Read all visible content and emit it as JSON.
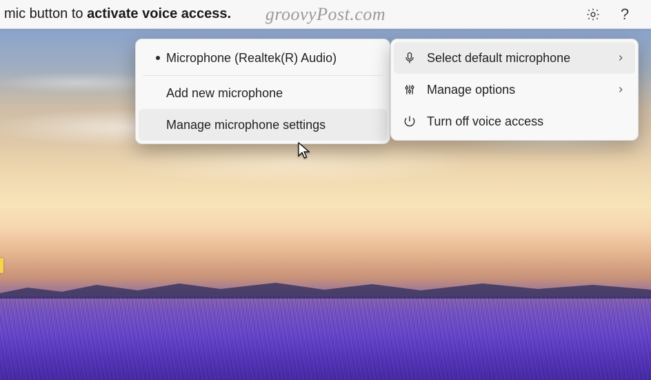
{
  "top_bar": {
    "message_prefix": "mic button to ",
    "message_bold": "activate voice access.",
    "watermark": "groovyPost.com"
  },
  "icons": {
    "settings": "gear-icon",
    "help": "help-icon",
    "help_glyph": "?"
  },
  "main_menu": {
    "items": [
      {
        "id": "select-mic",
        "label": "Select default microphone",
        "icon": "microphone-icon",
        "has_submenu": true,
        "selected": true
      },
      {
        "id": "manage-options",
        "label": "Manage options",
        "icon": "sliders-icon",
        "has_submenu": true,
        "selected": false
      },
      {
        "id": "turn-off",
        "label": "Turn off voice access",
        "icon": "power-icon",
        "has_submenu": false,
        "selected": false
      }
    ]
  },
  "sub_menu": {
    "items": [
      {
        "id": "mic-realtek",
        "label": "Microphone (Realtek(R) Audio)",
        "checked": true
      },
      {
        "id": "add-mic",
        "label": "Add new microphone",
        "checked": false
      },
      {
        "id": "manage-mic",
        "label": "Manage microphone settings",
        "checked": false,
        "hover": true
      }
    ]
  }
}
